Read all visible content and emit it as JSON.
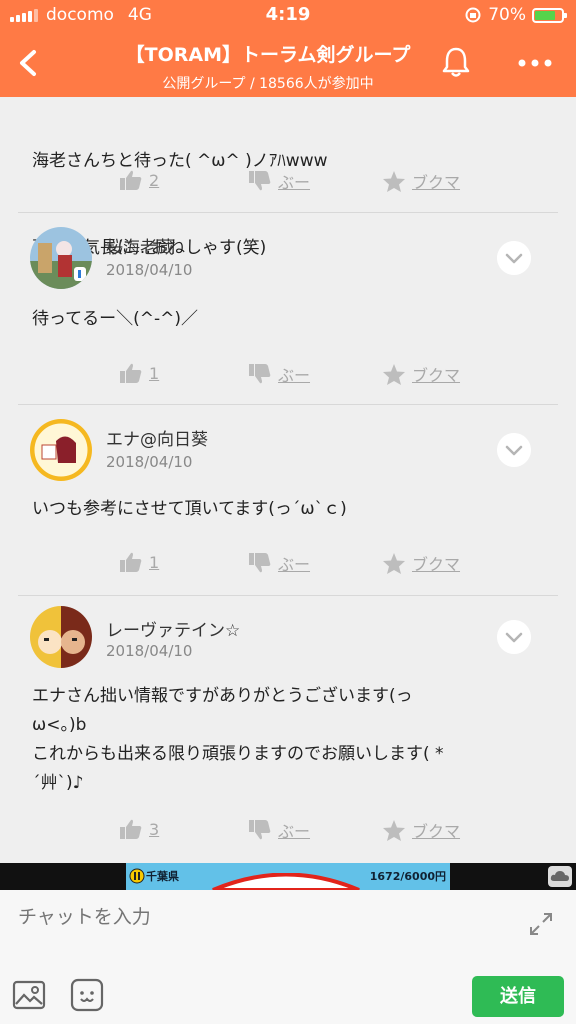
{
  "status": {
    "carrier": "docomo",
    "network": "4G",
    "time": "4:19",
    "battery": "70%",
    "battery_level": 0.7
  },
  "header": {
    "title": "【TORAM】トーラム剣グループ",
    "subtitle": "公開グループ / 18566人が参加中"
  },
  "top_post": {
    "text_line1": "海老さんちと待った( ^ω^ )ノｱﾊwww",
    "text_line2": "更新は気長に…おねしゃす(笑)",
    "likes": "2"
  },
  "posts": [
    {
      "name": "桜海老蔵",
      "date": "2018/04/10",
      "text": "待ってるー＼(^-^)／",
      "likes": "1"
    },
    {
      "name": "エナ@向日葵",
      "date": "2018/04/10",
      "text": "いつも参考にさせて頂いてます(っ´ω`ｃ)",
      "likes": "1"
    },
    {
      "name": "レーヴァテイン☆",
      "date": "2018/04/10",
      "text": "エナさん拙い情報ですがありがとうございます(っ\nω<。)b\nこれからも出来る限り頑張りますのでお願いします( *\n´艸`)♪",
      "likes": "3"
    }
  ],
  "action_labels": {
    "boo": "ぶー",
    "bookmark": "ブクマ"
  },
  "ad": {
    "left_text": "千葉県",
    "right_text": "1672/6000円"
  },
  "input": {
    "placeholder": "チャットを入力",
    "send_label": "送信"
  },
  "colors": {
    "accent": "#ff7a45",
    "send": "#2fbb55",
    "battery": "#57d34b"
  }
}
